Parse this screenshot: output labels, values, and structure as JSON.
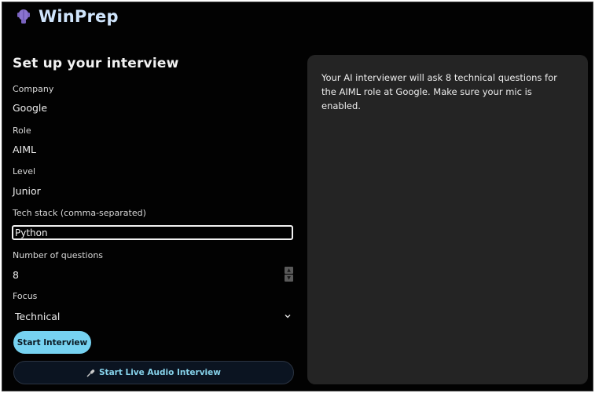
{
  "app": {
    "name": "WinPrep",
    "logo_icon": "brain-icon"
  },
  "form": {
    "heading": "Set up your interview",
    "company_label": "Company",
    "company_value": "Google",
    "role_label": "Role",
    "role_value": "AIML",
    "level_label": "Level",
    "level_value": "Junior",
    "techstack_label": "Tech stack (comma-separated)",
    "techstack_value": "Python",
    "num_questions_label": "Number of questions",
    "num_questions_value": "8",
    "focus_label": "Focus",
    "focus_value": "Technical",
    "start_button": "Start Interview",
    "live_audio_button": "Start Live Audio Interview",
    "live_audio_icon": "microphone-icon"
  },
  "panel": {
    "message": "Your AI interviewer will ask 8 technical questions for the AIML role at Google. Make sure your mic is enabled."
  },
  "colors": {
    "background": "#020202",
    "accent": "#76d2f1",
    "panel": "#242424",
    "brand_text": "#cfe4fb",
    "logo": "#8a73cf"
  }
}
